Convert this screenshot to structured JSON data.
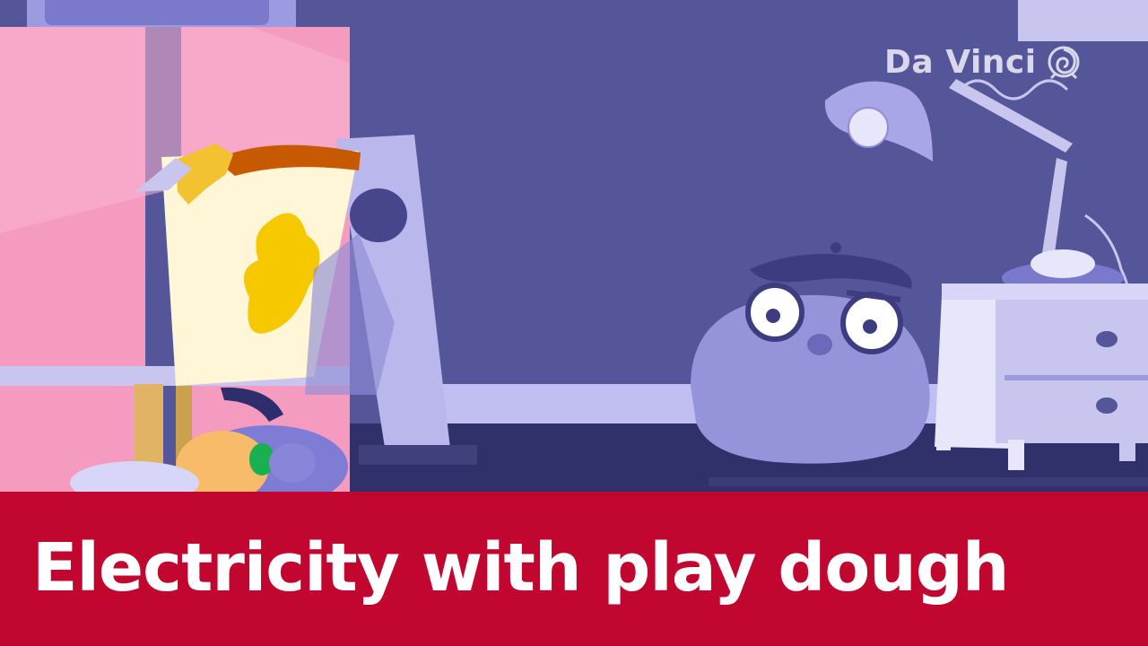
{
  "logo": {
    "text": "Da Vinci",
    "icon": "shell-icon"
  },
  "banner": {
    "title": "Electricity with play dough"
  },
  "colors": {
    "banner_background": "#c1062f",
    "banner_text": "#ffffff",
    "scene_background": "#55559a",
    "logo_text": "#d9d7ea"
  }
}
